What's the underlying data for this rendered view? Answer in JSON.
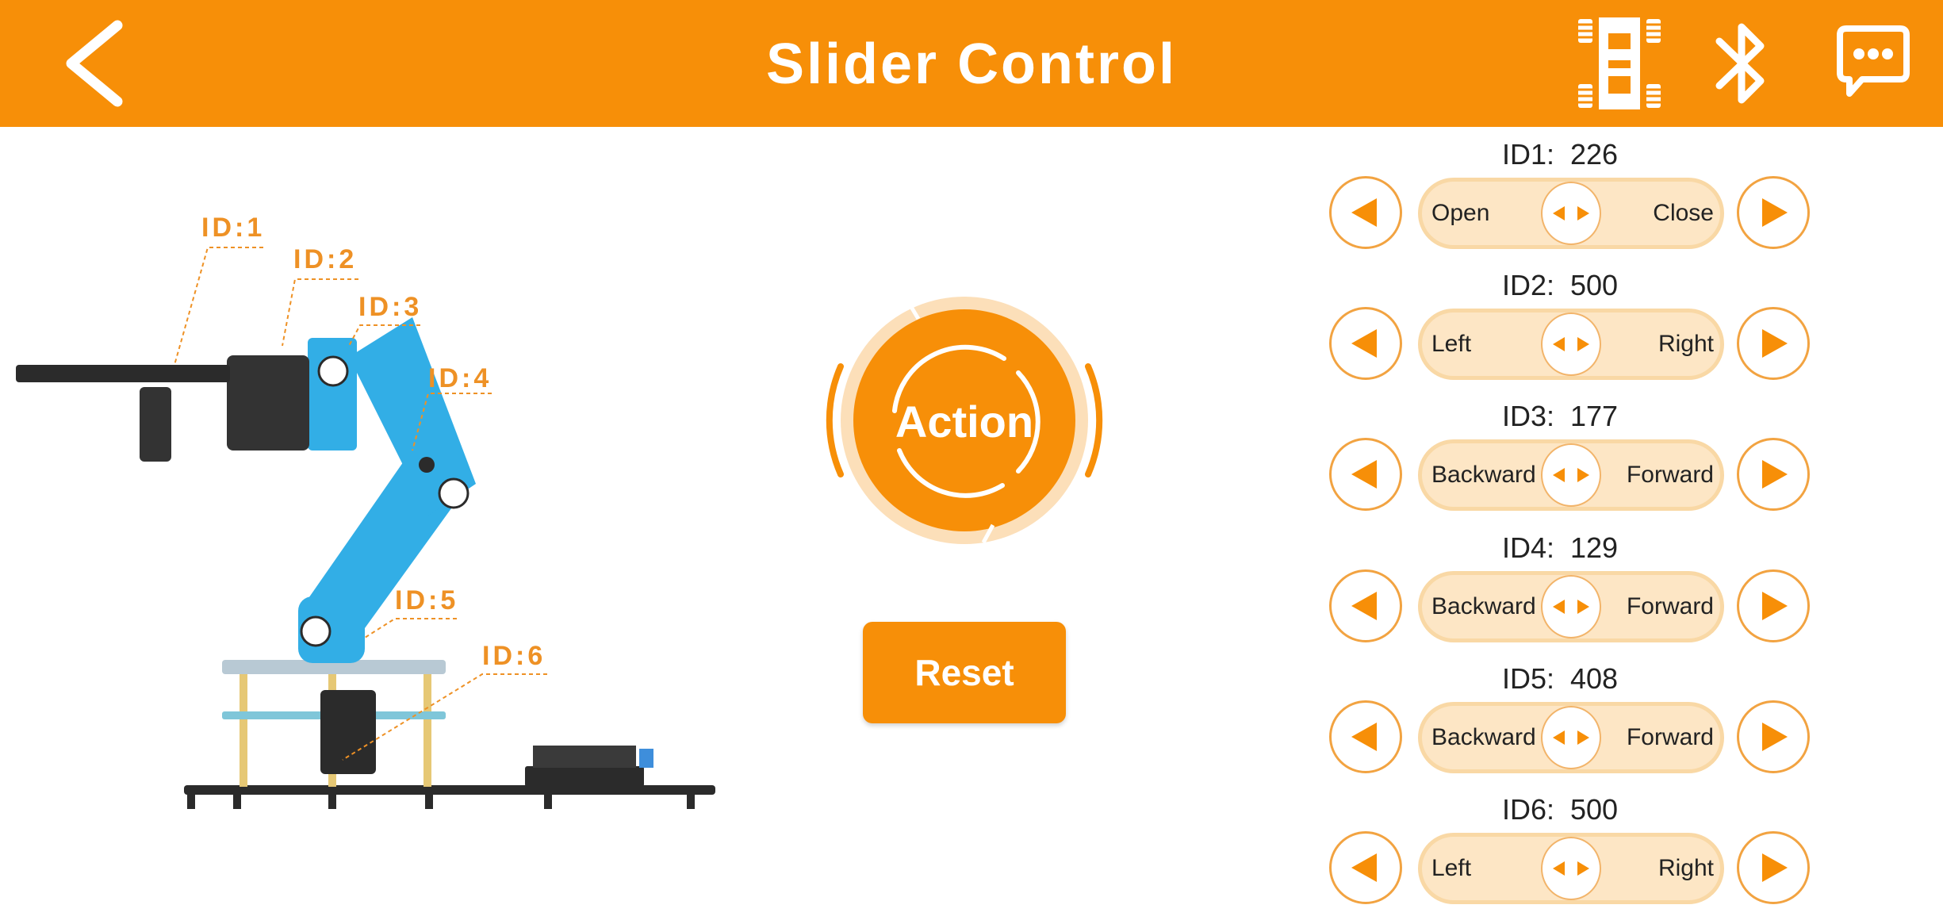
{
  "header": {
    "title": "Slider Control",
    "back_icon": "back-chevron-icon",
    "icons": [
      "car-mode-icon",
      "bluetooth-icon",
      "chat-icon"
    ]
  },
  "robot": {
    "labels": [
      "ID:1",
      "ID:2",
      "ID:3",
      "ID:4",
      "ID:5",
      "ID:6"
    ]
  },
  "action": {
    "label": "Action"
  },
  "reset": {
    "label": "Reset"
  },
  "servos": [
    {
      "id": "ID1:",
      "value": "226",
      "left": "Open",
      "right": "Close"
    },
    {
      "id": "ID2:",
      "value": "500",
      "left": "Left",
      "right": "Right"
    },
    {
      "id": "ID3:",
      "value": "177",
      "left": "Backward",
      "right": "Forward"
    },
    {
      "id": "ID4:",
      "value": "129",
      "left": "Backward",
      "right": "Forward"
    },
    {
      "id": "ID5:",
      "value": "408",
      "left": "Backward",
      "right": "Forward"
    },
    {
      "id": "ID6:",
      "value": "500",
      "left": "Left",
      "right": "Right"
    }
  ],
  "colors": {
    "accent": "#F78F08",
    "track": "#FDE6C5",
    "arm_blue": "#32AEE6",
    "label_orange": "#EE9125"
  }
}
